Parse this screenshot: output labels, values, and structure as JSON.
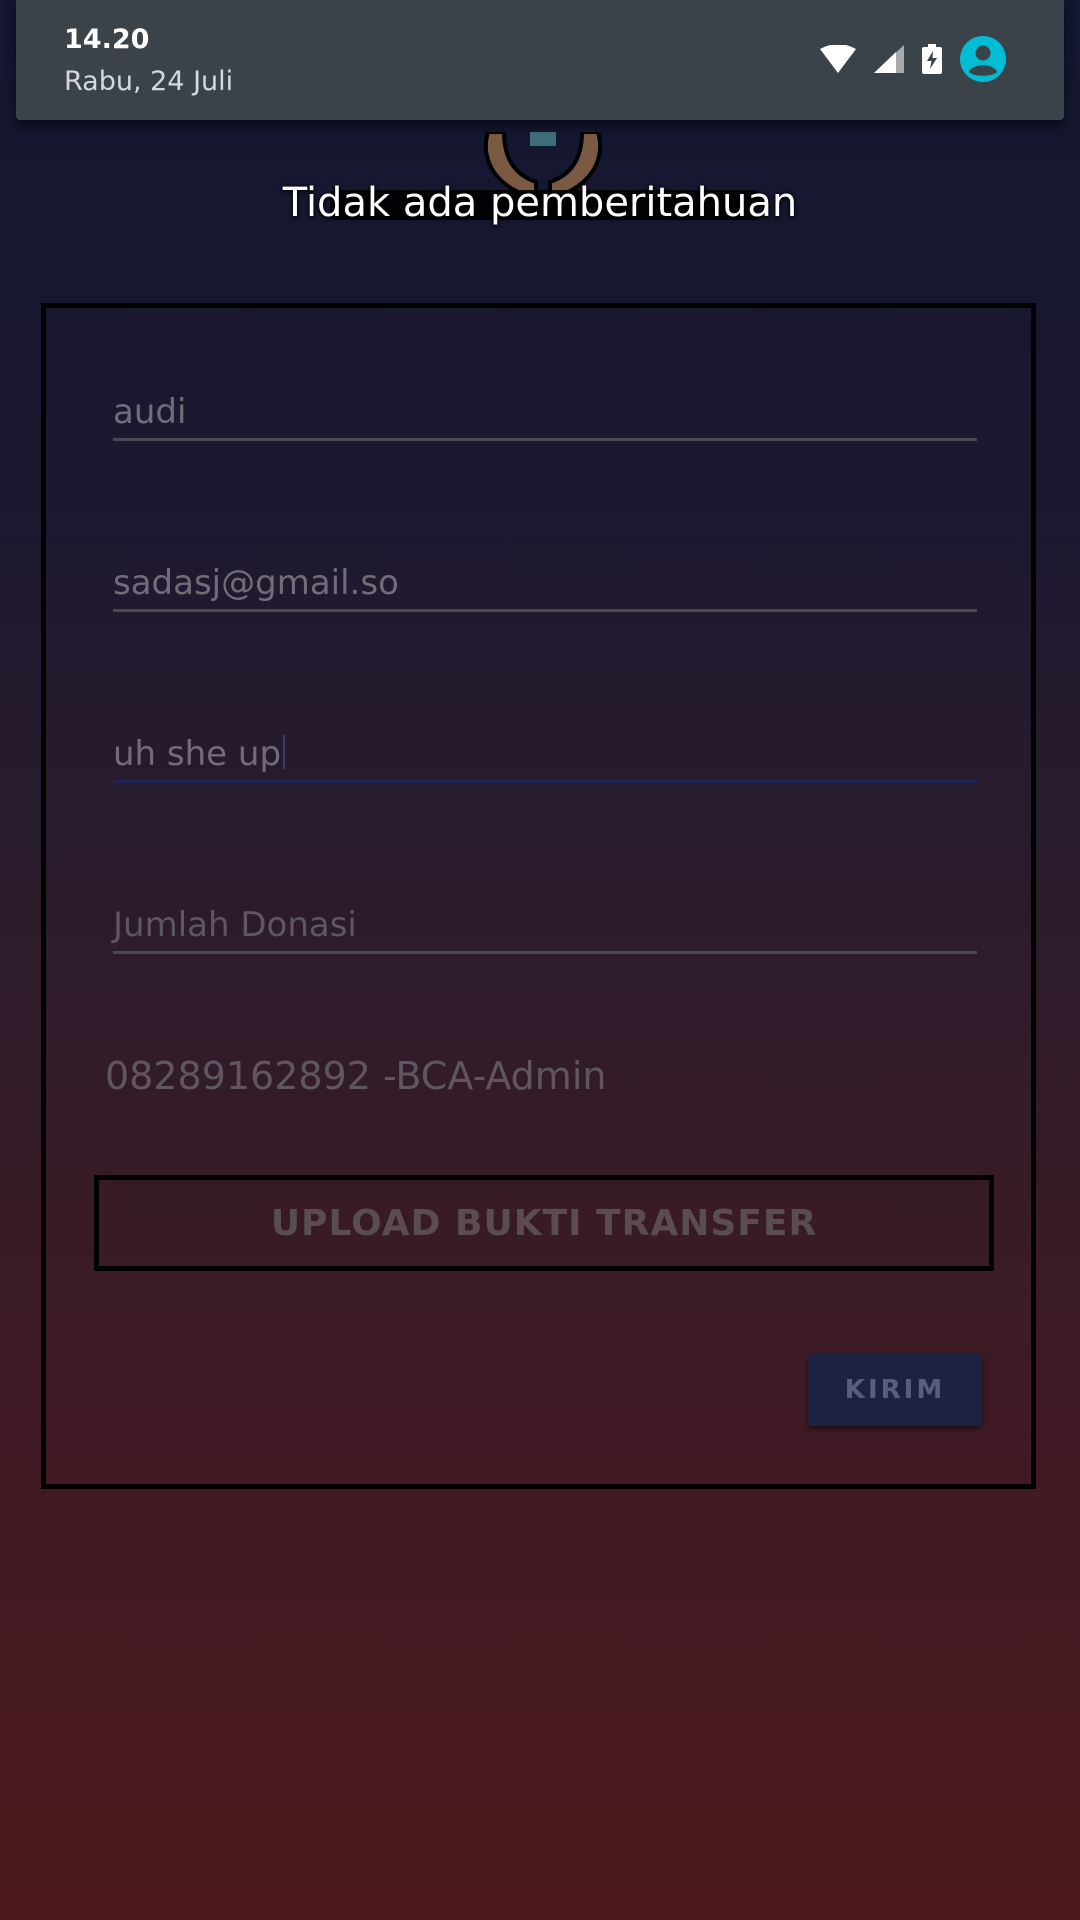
{
  "status_bar": {
    "time": "14.20",
    "date": "Rabu, 24 Juli",
    "icons": [
      "wifi-icon",
      "cellular-signal-icon",
      "battery-charging-icon",
      "account-icon"
    ],
    "accent_color": "#00bcd4"
  },
  "notification_shade": {
    "empty_message": "Tidak ada pemberitahuan"
  },
  "form": {
    "name_value": "audi",
    "email_value": "sadasj@gmail.so",
    "message_value": "uh she up",
    "amount_placeholder": "Jumlah Donasi",
    "amount_value": "",
    "account_info": "08289162892 -BCA-Admin",
    "upload_label": "UPLOAD BUKTI TRANSFER",
    "submit_label": "KIRIM"
  }
}
